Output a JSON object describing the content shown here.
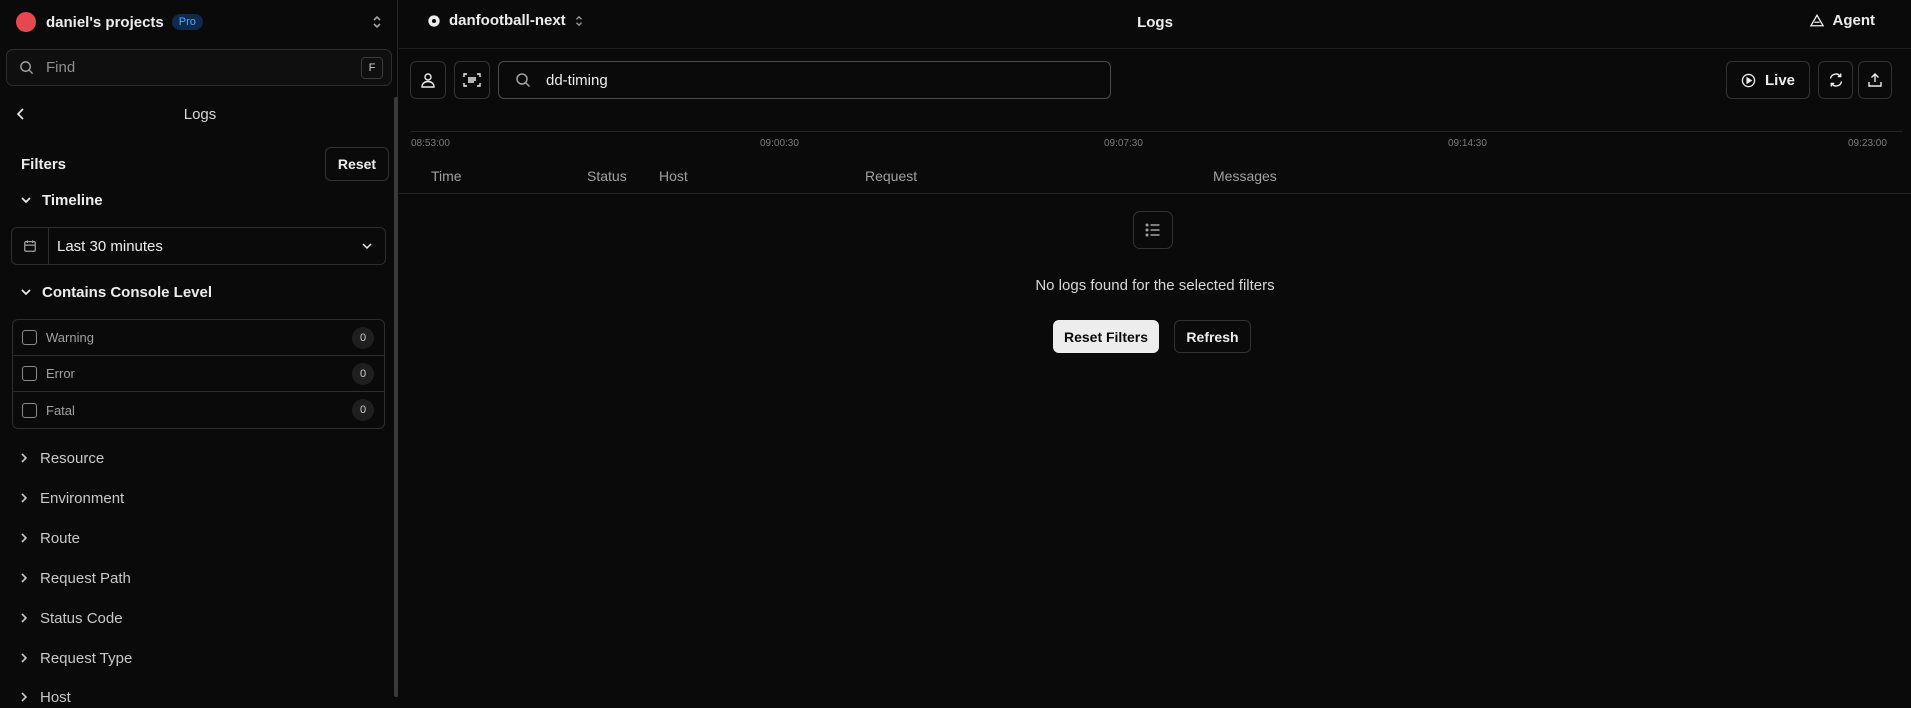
{
  "sidebar": {
    "project_name": "daniel's projects",
    "plan_badge": "Pro",
    "find_placeholder": "Find",
    "find_shortcut": "F",
    "panel_title": "Logs",
    "filters_label": "Filters",
    "reset_label": "Reset",
    "timeline": {
      "label": "Timeline",
      "value": "Last 30 minutes"
    },
    "console_level": {
      "label": "Contains Console Level",
      "levels": [
        {
          "name": "Warning",
          "count": "0"
        },
        {
          "name": "Error",
          "count": "0"
        },
        {
          "name": "Fatal",
          "count": "0"
        }
      ]
    },
    "sections": [
      "Resource",
      "Environment",
      "Route",
      "Request Path",
      "Status Code",
      "Request Type",
      "Host"
    ]
  },
  "topbar": {
    "project": "danfootball-next",
    "title": "Logs",
    "agent_label": "Agent"
  },
  "toolbar": {
    "search_value": "dd-timing",
    "live_label": "Live"
  },
  "timeline_ticks": [
    "08:53:00",
    "09:00:30",
    "09:07:30",
    "09:14:30",
    "09:23:00"
  ],
  "table": {
    "columns": [
      "Time",
      "Status",
      "Host",
      "Request",
      "Messages"
    ]
  },
  "empty_state": {
    "message": "No logs found for the selected filters",
    "reset_filters_label": "Reset Filters",
    "refresh_label": "Refresh"
  },
  "colors": {
    "brand_dot": "#e5484d",
    "pro_badge": "#52a8ff",
    "background": "#0a0a0a"
  }
}
